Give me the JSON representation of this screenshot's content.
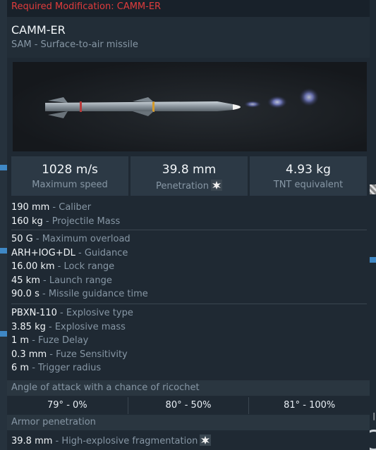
{
  "required_modification": "Required Modification: CAMM-ER",
  "title": "CAMM-ER",
  "subtitle": "SAM - Surface-to-air missile",
  "stats": [
    {
      "value": "1028 m/s",
      "label": "Maximum speed"
    },
    {
      "value": "39.8 mm",
      "label": "Penetration"
    },
    {
      "value": "4.93 kg",
      "label": "TNT equivalent"
    }
  ],
  "group1": [
    {
      "value": "190 mm",
      "label": " - Caliber"
    },
    {
      "value": "160 kg",
      "label": " - Projectile Mass"
    }
  ],
  "group2": [
    {
      "value": "50 G",
      "label": " - Maximum overload"
    },
    {
      "value": "ARH+IOG+DL",
      "label": " - Guidance"
    },
    {
      "value": "16.00 km",
      "label": " - Lock range"
    },
    {
      "value": "45 km",
      "label": " - Launch range"
    },
    {
      "value": "90.0 s",
      "label": " - Missile guidance time"
    }
  ],
  "group3": [
    {
      "value": "PBXN-110",
      "label": " - Explosive type"
    },
    {
      "value": "3.85 kg",
      "label": " - Explosive mass"
    },
    {
      "value": "1 m",
      "label": " - Fuze Delay"
    },
    {
      "value": "0.3 mm",
      "label": " - Fuze Sensitivity"
    },
    {
      "value": "6 m",
      "label": " - Trigger radius"
    }
  ],
  "ricochet": {
    "header": "Angle of attack with a chance of ricochet",
    "cells": [
      "79° - 0%",
      "80° - 50%",
      "81° - 100%"
    ]
  },
  "armor": {
    "header": "Armor penetration",
    "value": "39.8 mm",
    "label": " - High-explosive fragmentation"
  },
  "colors": {
    "required": "#e03c3c",
    "accent_band": "#3f88c5"
  },
  "icons": [
    "penetration-icon",
    "missile-image"
  ]
}
